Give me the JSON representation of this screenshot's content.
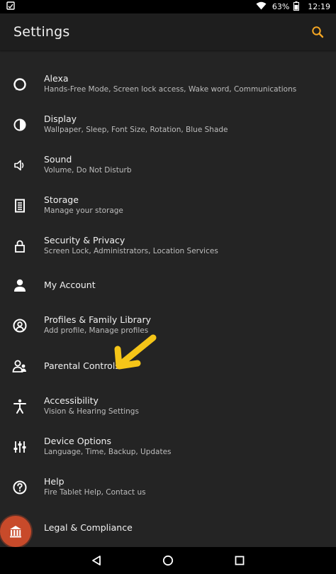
{
  "status_bar": {
    "battery_percent": "63%",
    "time": "12:19"
  },
  "app_bar": {
    "title": "Settings",
    "search_icon": "search-icon",
    "accent_color": "#f5a623"
  },
  "settings": [
    {
      "title": "Alexa",
      "subtitle": "Hands-Free Mode, Screen lock access, Wake word, Communications",
      "icon": "alexa-icon"
    },
    {
      "title": "Display",
      "subtitle": "Wallpaper, Sleep, Font Size, Rotation, Blue Shade",
      "icon": "display-icon"
    },
    {
      "title": "Sound",
      "subtitle": "Volume, Do Not Disturb",
      "icon": "speaker-icon"
    },
    {
      "title": "Storage",
      "subtitle": "Manage your storage",
      "icon": "storage-icon"
    },
    {
      "title": "Security & Privacy",
      "subtitle": "Screen Lock, Administrators, Location Services",
      "icon": "lock-icon"
    },
    {
      "title": "My Account",
      "subtitle": "",
      "icon": "person-icon"
    },
    {
      "title": "Profiles & Family Library",
      "subtitle": "Add profile, Manage profiles",
      "icon": "profile-icon"
    },
    {
      "title": "Parental Controls",
      "subtitle": "",
      "icon": "parental-icon"
    },
    {
      "title": "Accessibility",
      "subtitle": "Vision & Hearing Settings",
      "icon": "accessibility-icon"
    },
    {
      "title": "Device Options",
      "subtitle": "Language, Time, Backup, Updates",
      "icon": "sliders-icon"
    },
    {
      "title": "Help",
      "subtitle": "Fire Tablet Help, Contact us",
      "icon": "help-icon"
    },
    {
      "title": "Legal & Compliance",
      "subtitle": "",
      "icon": "legal-icon"
    }
  ],
  "nav_bar": {
    "back_icon": "back-triangle-icon",
    "home_icon": "home-circle-icon",
    "recents_icon": "recents-square-icon"
  },
  "annotation": {
    "arrow_color": "#f5c518"
  }
}
